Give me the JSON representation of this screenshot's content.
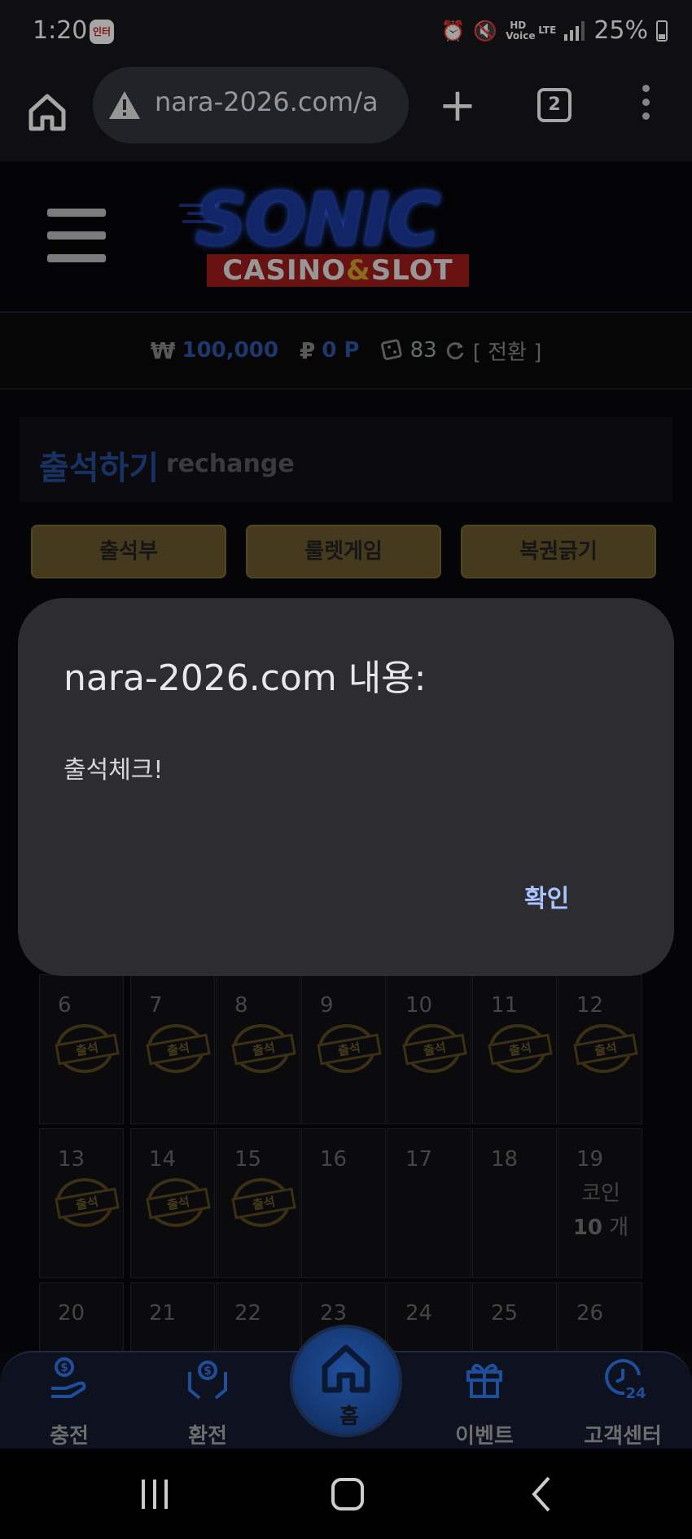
{
  "status_bar": {
    "time": "1:20",
    "app_icon_text": "인터",
    "hd_label": "HD Voice",
    "lte_label": "LTE",
    "battery": "25%"
  },
  "browser": {
    "url": "nara-2026.com/a",
    "tab_count": "2"
  },
  "header": {
    "logo_main": "SONIC",
    "logo_sub_left": "CASINO",
    "logo_sub_amp": "&",
    "logo_sub_right": "SLOT"
  },
  "balance": {
    "currency_symbol": "₩",
    "money": "100,000",
    "point_symbol": "₽",
    "points": "0 P",
    "coins": "83",
    "switch_label": "[ 전환 ]"
  },
  "section": {
    "title": "출석하기",
    "subtitle": "rechange",
    "tabs": [
      "출석부",
      "룰렛게임",
      "복권긁기"
    ]
  },
  "calendar": {
    "stamp_label": "출석",
    "rows": [
      [
        {
          "day": "6",
          "stamped": true
        },
        {
          "day": "7",
          "stamped": true
        },
        {
          "day": "8",
          "stamped": true
        },
        {
          "day": "9",
          "stamped": true
        },
        {
          "day": "10",
          "stamped": true
        },
        {
          "day": "11",
          "stamped": true
        },
        {
          "day": "12",
          "stamped": true
        }
      ],
      [
        {
          "day": "13",
          "stamped": true
        },
        {
          "day": "14",
          "stamped": true
        },
        {
          "day": "15",
          "stamped": true
        },
        {
          "day": "16",
          "stamped": false
        },
        {
          "day": "17",
          "stamped": false
        },
        {
          "day": "18",
          "stamped": false
        },
        {
          "day": "19",
          "stamped": false,
          "reward_label": "코인",
          "reward_amount": "10",
          "reward_unit": "개"
        }
      ],
      [
        {
          "day": "20",
          "stamped": false
        },
        {
          "day": "21",
          "stamped": false
        },
        {
          "day": "22",
          "stamped": false
        },
        {
          "day": "23",
          "stamped": false
        },
        {
          "day": "24",
          "stamped": false
        },
        {
          "day": "25",
          "stamped": false
        },
        {
          "day": "26",
          "stamped": false
        }
      ]
    ]
  },
  "dialog": {
    "title": "nara-2026.com 내용:",
    "message": "출석체크!",
    "confirm": "확인"
  },
  "bottom_nav": {
    "items": [
      {
        "label": "충전",
        "icon": "deposit-hand-icon"
      },
      {
        "label": "환전",
        "icon": "exchange-hand-icon"
      },
      {
        "label": "홈",
        "icon": "home-icon"
      },
      {
        "label": "이벤트",
        "icon": "gift-icon"
      },
      {
        "label": "고객센터",
        "icon": "support-24-icon"
      }
    ]
  },
  "colors": {
    "accent_blue": "#254e9a",
    "tab_gold": "#6b5a2d",
    "dialog_bg": "#2d2d31",
    "confirm_blue": "#a9c3ff"
  }
}
